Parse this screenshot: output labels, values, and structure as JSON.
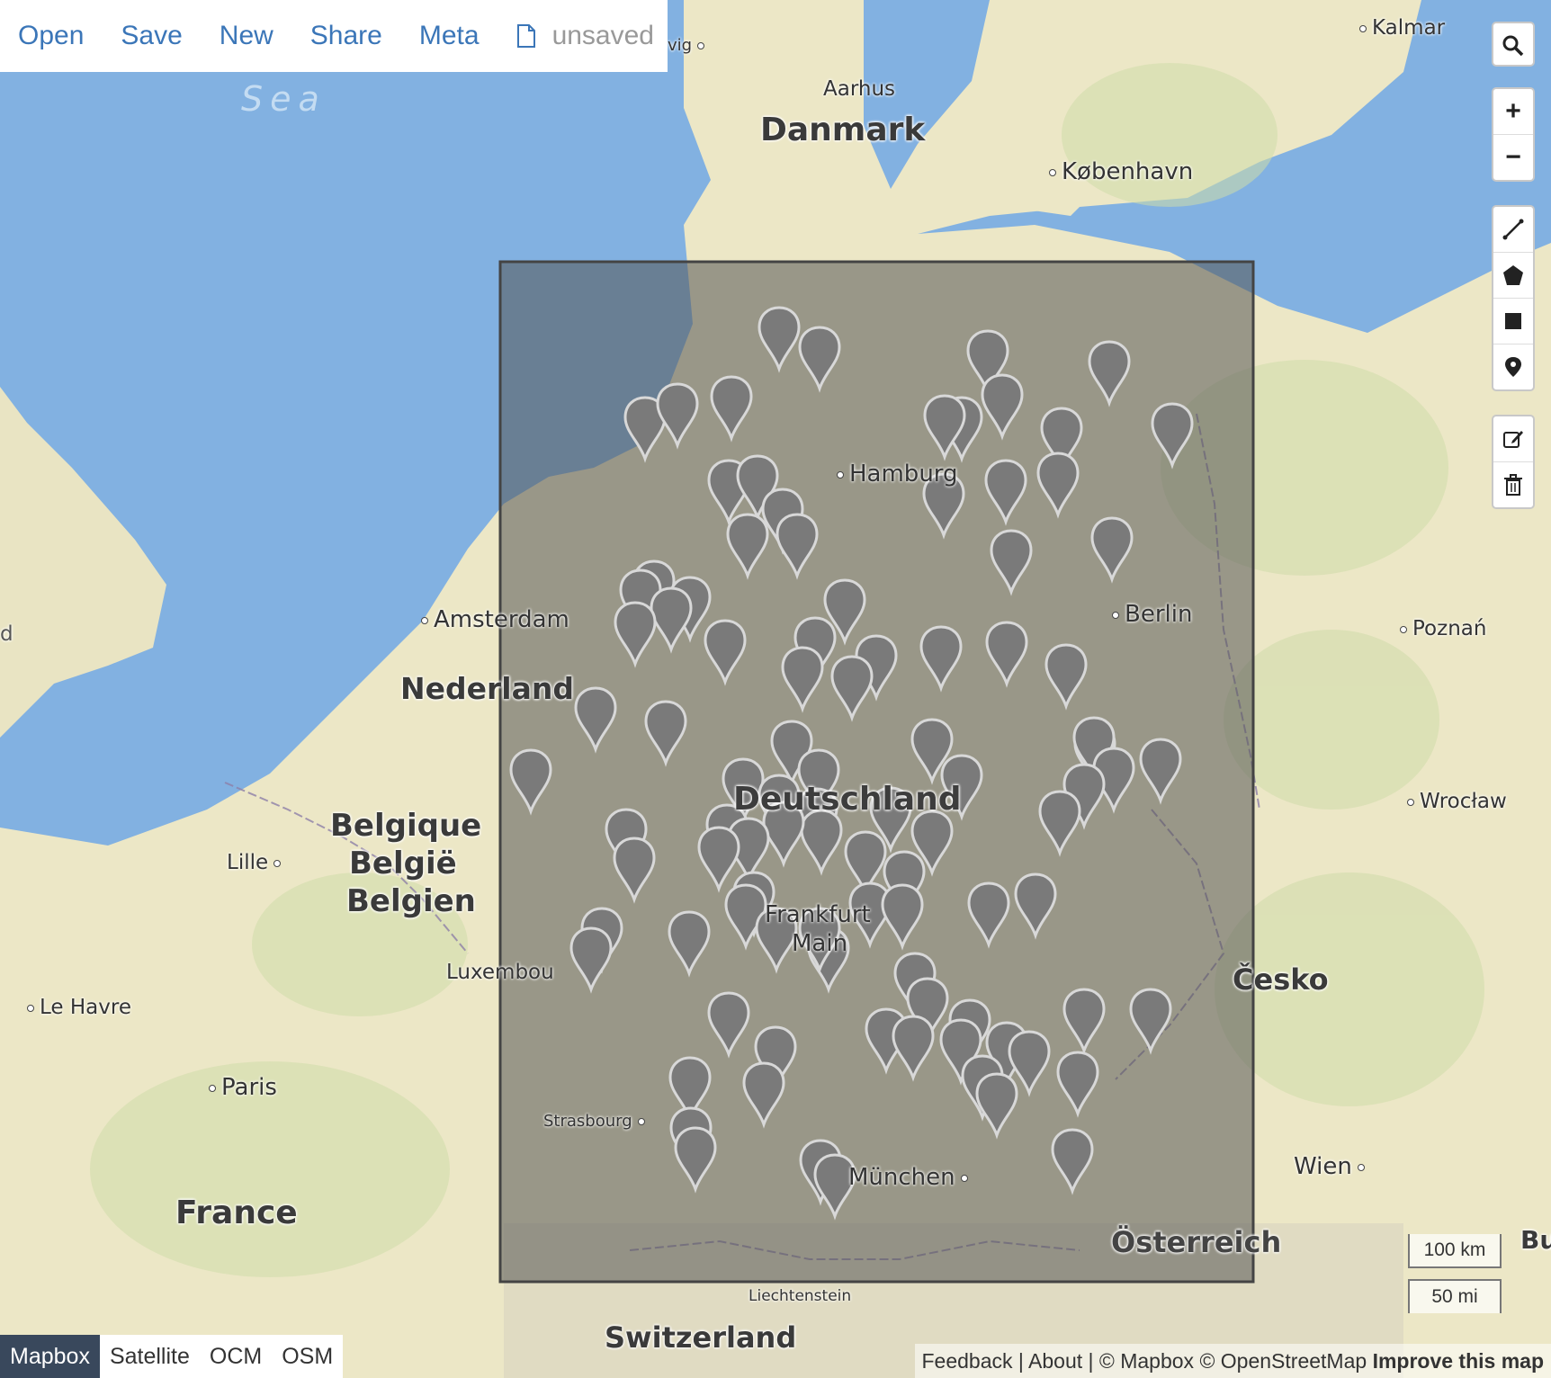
{
  "toolbar": {
    "open": "Open",
    "save": "Save",
    "new": "New",
    "share": "Share",
    "meta": "Meta",
    "file_icon": "file-icon",
    "status": "unsaved"
  },
  "map_labels": {
    "sea": "Sea",
    "danmark": "Danmark",
    "nederland": "Nederland",
    "belgique": "Belgique",
    "belgie": "België",
    "belgien": "Belgien",
    "france": "France",
    "switzerland": "Switzerland",
    "cesko": "Česko",
    "osterreich": "Österreich",
    "deutschland_fragment": "Deutschland",
    "aarhus": "Aarhus",
    "kobenhavn": "København",
    "kalmar": "Kalmar",
    "hamburg": "Hamburg",
    "berlin": "Berlin",
    "poznan": "Poznań",
    "wroclaw": "Wrocław",
    "amsterdam": "Amsterdam",
    "lille": "Lille",
    "le_havre": "Le Havre",
    "paris": "Paris",
    "luxembourg": "Luxembou",
    "strasbourg": "Strasbourg",
    "frankfurt": "Frankfurt",
    "main": "Main",
    "munchen": "München",
    "wien": "Wien",
    "liechtenstein": "Liechtenstein",
    "vig": "vig",
    "bu": "Bu",
    "d_left": "d"
  },
  "controls": {
    "search_icon": "search-icon",
    "zoom_in": "+",
    "zoom_out": "−",
    "draw_line_icon": "line-icon",
    "draw_polygon_icon": "polygon-icon",
    "draw_rectangle_icon": "rectangle-icon",
    "draw_marker_icon": "marker-icon",
    "edit_icon": "edit-icon",
    "delete_icon": "trash-icon"
  },
  "layers": [
    "Mapbox",
    "Satellite",
    "OCM",
    "OSM"
  ],
  "active_layer": "Mapbox",
  "scale": {
    "metric": "100 km",
    "imperial": "50 mi"
  },
  "attribution": {
    "feedback": "Feedback",
    "about": "About",
    "mapbox": "© Mapbox",
    "osm": "© OpenStreetMap",
    "improve": "Improve this map"
  },
  "overlay_color": "#555555",
  "marker_color": "#7a7a7a"
}
